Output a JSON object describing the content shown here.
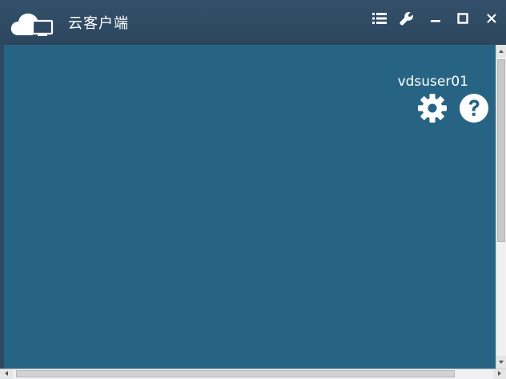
{
  "window": {
    "title": "云客户端",
    "controls": {
      "menu_icon": "list-icon",
      "settings_icon": "wrench-icon",
      "minimize_icon": "minimize-icon",
      "maximize_icon": "maximize-icon",
      "close_icon": "close-icon"
    }
  },
  "main": {
    "username": "vdsuser01",
    "settings_icon": "gear-icon",
    "help_icon": "question-circle-icon"
  },
  "colors": {
    "titlebar": "#2e4a63",
    "content": "#276483",
    "icon": "#ffffff"
  }
}
